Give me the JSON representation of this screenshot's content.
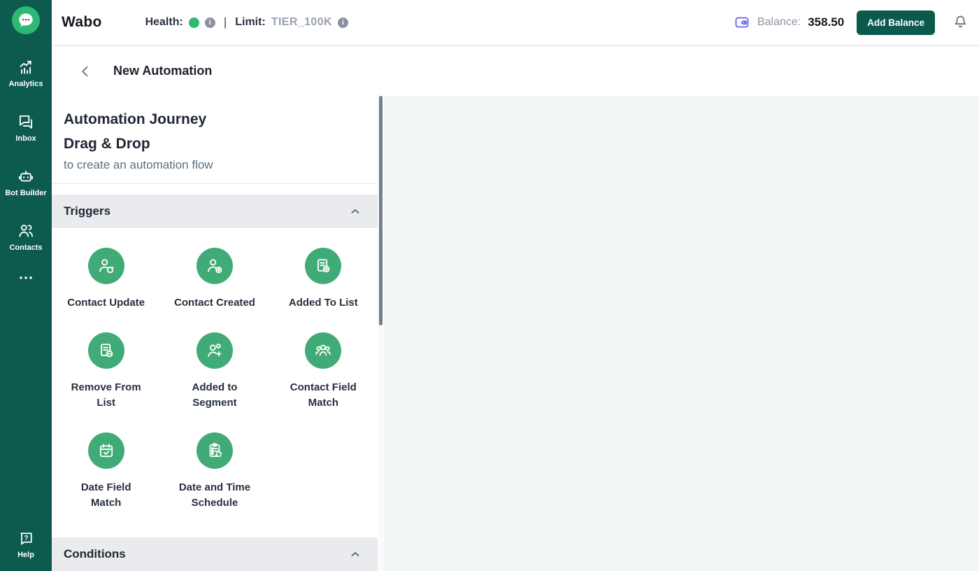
{
  "header": {
    "brand": "Wabo",
    "health_label": "Health:",
    "separator": "|",
    "limit_label": "Limit:",
    "limit_value": "TIER_100K",
    "balance_label": "Balance:",
    "balance_value": "358.50",
    "add_balance_label": "Add Balance",
    "health_status_color": "#2eb873"
  },
  "subheader": {
    "title": "New Automation"
  },
  "sidebar": {
    "items": [
      {
        "label": "Analytics",
        "icon": "analytics-icon"
      },
      {
        "label": "Inbox",
        "icon": "inbox-icon"
      },
      {
        "label": "Bot Builder",
        "icon": "bot-builder-icon"
      },
      {
        "label": "Contacts",
        "icon": "contacts-icon"
      }
    ],
    "more_icon": "more-dots-icon",
    "help": {
      "label": "Help",
      "icon": "help-icon"
    }
  },
  "panel": {
    "title_line1": "Automation Journey",
    "title_line2": "Drag & Drop",
    "subtitle": "to create an automation flow",
    "sections": [
      {
        "label": "Triggers",
        "collapsed": false,
        "items": [
          {
            "label": "Contact Update",
            "icon": "contact-update-icon"
          },
          {
            "label": "Contact Created",
            "icon": "contact-created-icon"
          },
          {
            "label": "Added To List",
            "icon": "added-to-list-icon"
          },
          {
            "label": "Remove From List",
            "icon": "remove-from-list-icon"
          },
          {
            "label": "Added to Segment",
            "icon": "added-to-segment-icon"
          },
          {
            "label": "Contact Field Match",
            "icon": "contact-field-match-icon"
          },
          {
            "label": "Date Field Match",
            "icon": "date-field-match-icon"
          },
          {
            "label": "Date and Time Schedule",
            "icon": "date-time-schedule-icon"
          }
        ]
      },
      {
        "label": "Conditions",
        "collapsed": false,
        "items": []
      }
    ]
  },
  "colors": {
    "sidebar_bg": "#0d5b4e",
    "logo_green": "#2fb873",
    "trigger_circle_green": "#41ab77",
    "add_balance_button": "#0b5a4d",
    "wallet_icon_accent": "#6366f1",
    "canvas_bg": "#f1f5f3",
    "section_bar_bg": "#e9ebee"
  }
}
